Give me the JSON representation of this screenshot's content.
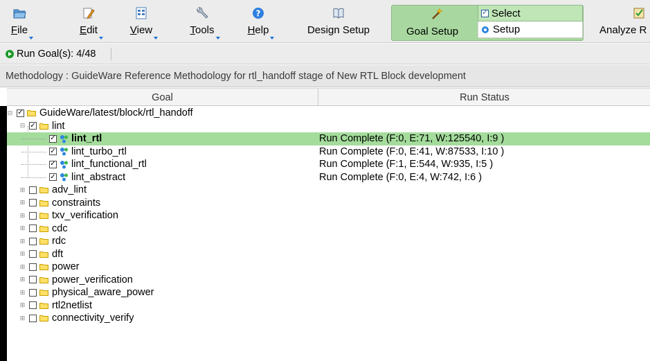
{
  "toolbar": {
    "file": {
      "label_first": "F",
      "label_rest": "ile"
    },
    "edit": {
      "label_first": "E",
      "label_rest": "dit"
    },
    "view": {
      "label_first": "V",
      "label_rest": "iew"
    },
    "tools": {
      "label_first": "T",
      "label_rest": "ools"
    },
    "help": {
      "label_first": "H",
      "label_rest": "elp"
    },
    "design_setup": "Design Setup",
    "goal_setup": "Goal Setup",
    "goal_menu": {
      "select": "Select",
      "setup": "Setup"
    },
    "analyze": "Analyze R"
  },
  "runbar": {
    "label": "Run Goal(s): 4/48"
  },
  "methodology": {
    "text": "Methodology : GuideWare Reference Methodology for rtl_handoff stage of New RTL Block development"
  },
  "table": {
    "headers": {
      "goal": "Goal",
      "status": "Run Status"
    },
    "rows": [
      {
        "label": "GuideWare/latest/block/rtl_handoff",
        "status": ""
      },
      {
        "label": "lint",
        "status": ""
      },
      {
        "label": "lint_rtl",
        "status": "Run Complete (F:0, E:71, W:125540, I:9 )"
      },
      {
        "label": "lint_turbo_rtl",
        "status": "Run Complete (F:0, E:41, W:87533, I:10 )"
      },
      {
        "label": "lint_functional_rtl",
        "status": "Run Complete (F:1, E:544, W:935, I:5 )"
      },
      {
        "label": "lint_abstract",
        "status": "Run Complete (F:0, E:4, W:742, I:6 )"
      },
      {
        "label": "adv_lint",
        "status": ""
      },
      {
        "label": "constraints",
        "status": ""
      },
      {
        "label": "txv_verification",
        "status": ""
      },
      {
        "label": "cdc",
        "status": ""
      },
      {
        "label": "rdc",
        "status": ""
      },
      {
        "label": "dft",
        "status": ""
      },
      {
        "label": "power",
        "status": ""
      },
      {
        "label": "power_verification",
        "status": ""
      },
      {
        "label": "physical_aware_power",
        "status": ""
      },
      {
        "label": "rtl2netlist",
        "status": ""
      },
      {
        "label": "connectivity_verify",
        "status": ""
      }
    ]
  },
  "colors": {
    "selected_row": "#a4dc9c",
    "goal_setup_bg": "#a8d8a0",
    "folder": "#e8b800"
  }
}
